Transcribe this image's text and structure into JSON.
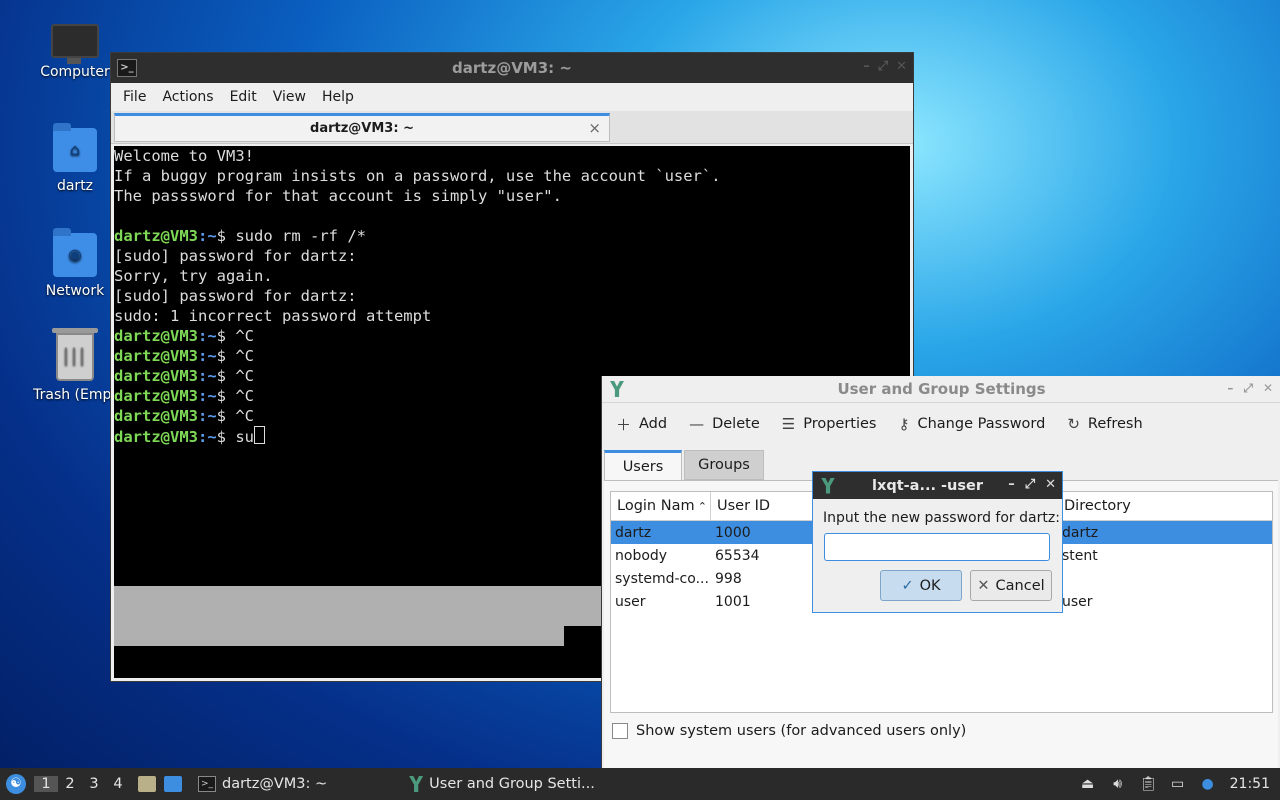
{
  "desktop": {
    "icons": [
      {
        "label": "Computer"
      },
      {
        "label": "dartz"
      },
      {
        "label": "Network"
      },
      {
        "label": "Trash (Empt"
      }
    ]
  },
  "terminal": {
    "title": "dartz@VM3: ~",
    "menu": [
      "File",
      "Actions",
      "Edit",
      "View",
      "Help"
    ],
    "tab_label": "dartz@VM3: ~",
    "tab_close": "×",
    "lines": [
      {
        "prompt": "",
        "text": "Welcome to VM3!"
      },
      {
        "prompt": "",
        "text": "If a buggy program insists on a password, use the account `user`."
      },
      {
        "prompt": "",
        "text": "The passsword for that account is simply \"user\"."
      },
      {
        "prompt": "",
        "text": ""
      },
      {
        "prompt": "dartz@VM3",
        "text": "$ sudo rm -rf /*"
      },
      {
        "prompt": "",
        "text": "[sudo] password for dartz:"
      },
      {
        "prompt": "",
        "text": "Sorry, try again."
      },
      {
        "prompt": "",
        "text": "[sudo] password for dartz:"
      },
      {
        "prompt": "",
        "text": "sudo: 1 incorrect password attempt"
      },
      {
        "prompt": "dartz@VM3",
        "text": "$ ^C"
      },
      {
        "prompt": "dartz@VM3",
        "text": "$ ^C"
      },
      {
        "prompt": "dartz@VM3",
        "text": "$ ^C"
      },
      {
        "prompt": "dartz@VM3",
        "text": "$ ^C"
      },
      {
        "prompt": "dartz@VM3",
        "text": "$ ^C"
      },
      {
        "prompt": "dartz@VM3",
        "text": "$ su"
      }
    ],
    "prompt_suffix": ":~"
  },
  "user_group": {
    "title": "User and Group Settings",
    "toolbar": {
      "add": "Add",
      "delete": "Delete",
      "properties": "Properties",
      "change_password": "Change Password",
      "refresh": "Refresh"
    },
    "tabs": {
      "users": "Users",
      "groups": "Groups"
    },
    "columns": {
      "login": "Login Nam",
      "uid": "User ID",
      "home": "Directory"
    },
    "rows": [
      {
        "login": "dartz",
        "uid": "1000",
        "home": "dartz"
      },
      {
        "login": "nobody",
        "uid": "65534",
        "home": "stent"
      },
      {
        "login": "systemd-co...",
        "uid": "998",
        "home": ""
      },
      {
        "login": "user",
        "uid": "1001",
        "home": "user"
      }
    ],
    "show_system": "Show system users (for advanced users only)"
  },
  "dialog": {
    "title": "lxqt-a... -user",
    "label": "Input the new password for dartz:",
    "ok": "OK",
    "cancel": "Cancel"
  },
  "taskbar": {
    "workspaces": [
      "1",
      "2",
      "3",
      "4"
    ],
    "tasks": [
      {
        "label": "dartz@VM3: ~"
      },
      {
        "label": "User and Group Setti..."
      }
    ],
    "clock": "21:51"
  }
}
